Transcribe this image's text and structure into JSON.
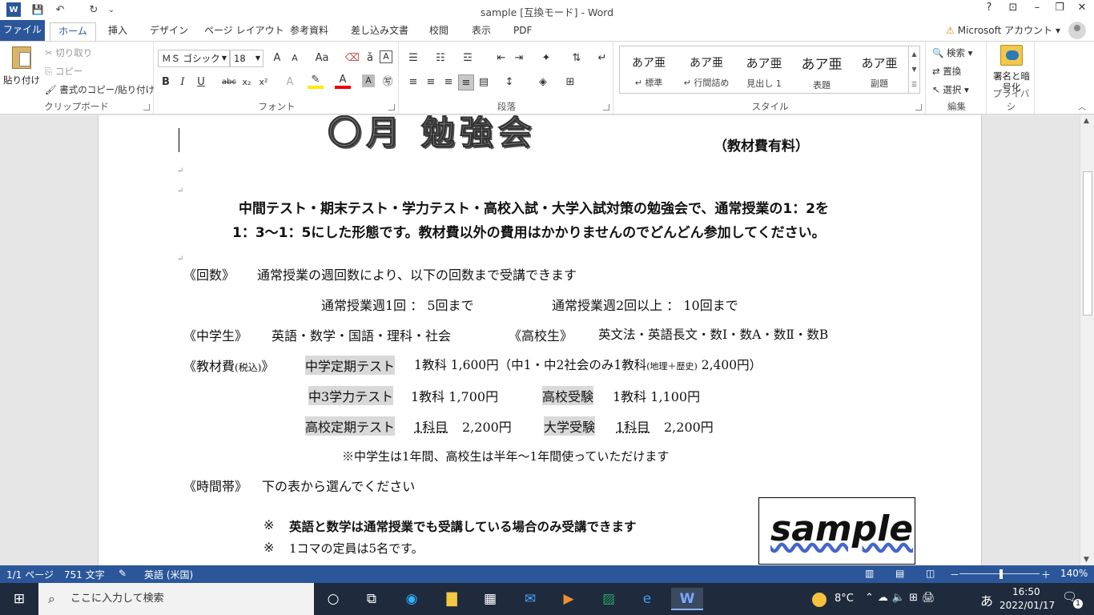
{
  "window": {
    "title": "sample [互換モード] - Word",
    "help": "?",
    "minimize": "–",
    "restore": "❐",
    "close": "✕"
  },
  "quick_access": {
    "save": "💾",
    "undo": "↶",
    "redo": "↻",
    "more": "⌄"
  },
  "tabs": [
    "ファイル",
    "ホーム",
    "挿入",
    "デザイン",
    "ページ レイアウト",
    "参考資料",
    "差し込み文書",
    "校閲",
    "表示",
    "PDF"
  ],
  "account": {
    "warning": "⚠",
    "label": "Microsoft アカウント ▾"
  },
  "ribbon": {
    "clipboard": {
      "paste": "貼り付け",
      "cut": "切り取り",
      "copy": "コピー",
      "format_painter": "書式のコピー/貼り付け",
      "label": "クリップボード"
    },
    "font": {
      "name": "ＭＳ ゴシック",
      "size": "18",
      "label": "フォント"
    },
    "paragraph": {
      "label": "段落"
    },
    "styles": {
      "items": [
        {
          "preview": "あア亜",
          "name": "↵ 標準"
        },
        {
          "preview": "あア亜",
          "name": "↵ 行間詰め"
        },
        {
          "preview": "あア亜",
          "name": "見出し 1"
        },
        {
          "preview": "あア亜",
          "name": "表題"
        },
        {
          "preview": "あア亜",
          "name": "副題"
        }
      ],
      "label": "スタイル"
    },
    "editing": {
      "find": "検索",
      "replace": "置換",
      "select": "選択",
      "label": "編集"
    },
    "privacy": {
      "sign": "署名と暗号化",
      "label": "プライバシ"
    }
  },
  "document": {
    "heading_art": "〇月 勉強会",
    "heading_note": "（教材費有料）",
    "intro_1": "中間テスト・期末テスト・学力テスト・高校入試・大学入試対策の勉強会で、通常授業の1：2を",
    "intro_2": "1：3～1：5にした形態です。教材費以外の費用はかかりませんのでどんどん参加してください。",
    "count_label": "《回数》",
    "count_text": "通常授業の週回数により、以下の回数まで受講できます",
    "count_a": "通常授業週1回 ： 5回まで",
    "count_b": "通常授業週2回以上 ： 10回まで",
    "jh_label": "《中学生》",
    "jh_subjects": "英語・数学・国語・理科・社会",
    "hs_label": "《高校生》",
    "hs_subjects": "英文法・英語長文・数Ⅰ・数A・数Ⅱ・数B",
    "fee_label": "《教材費",
    "fee_tax": "(税込)",
    "fee_close": "》",
    "fee_1_name": "中学定期テスト",
    "fee_1_text": "1教科 1,600円（中1・中2社会のみ1教科",
    "fee_1_small": "(地理＋歴史)",
    "fee_1_end": " 2,400円）",
    "fee_2_name": "中3学力テスト",
    "fee_2_text": "1教科 1,700円",
    "fee_3_name": "高校受験",
    "fee_3_text": "1教科 1,100円",
    "fee_4_name": "高校定期テスト",
    "fee_4_unit": "1科目",
    "fee_4_price": "2,200円",
    "fee_5_name": "大学受験",
    "fee_5_unit": "1科目",
    "fee_5_price": "2,200円",
    "fee_note": "※中学生は1年間、高校生は半年～1年間使っていただけます",
    "time_label": "《時間帯》",
    "time_text": "下の表から選んでください",
    "note_1_mark": "※",
    "note_1": "英語と数学は通常授業でも受講している場合のみ受講できます",
    "note_2_mark": "※",
    "note_2": "1コマの定員は5名です。",
    "stamp": "sample"
  },
  "status": {
    "page": "1/1 ページ",
    "words": "751 文字",
    "lang": "英語 (米国)",
    "zoom": "140%",
    "zoom_minus": "－",
    "zoom_plus": "＋"
  },
  "taskbar": {
    "search": "ここに入力して検索",
    "weather": "8°C",
    "ime": "あ",
    "time": "16:50",
    "date": "2022/01/17",
    "notif": "1"
  }
}
